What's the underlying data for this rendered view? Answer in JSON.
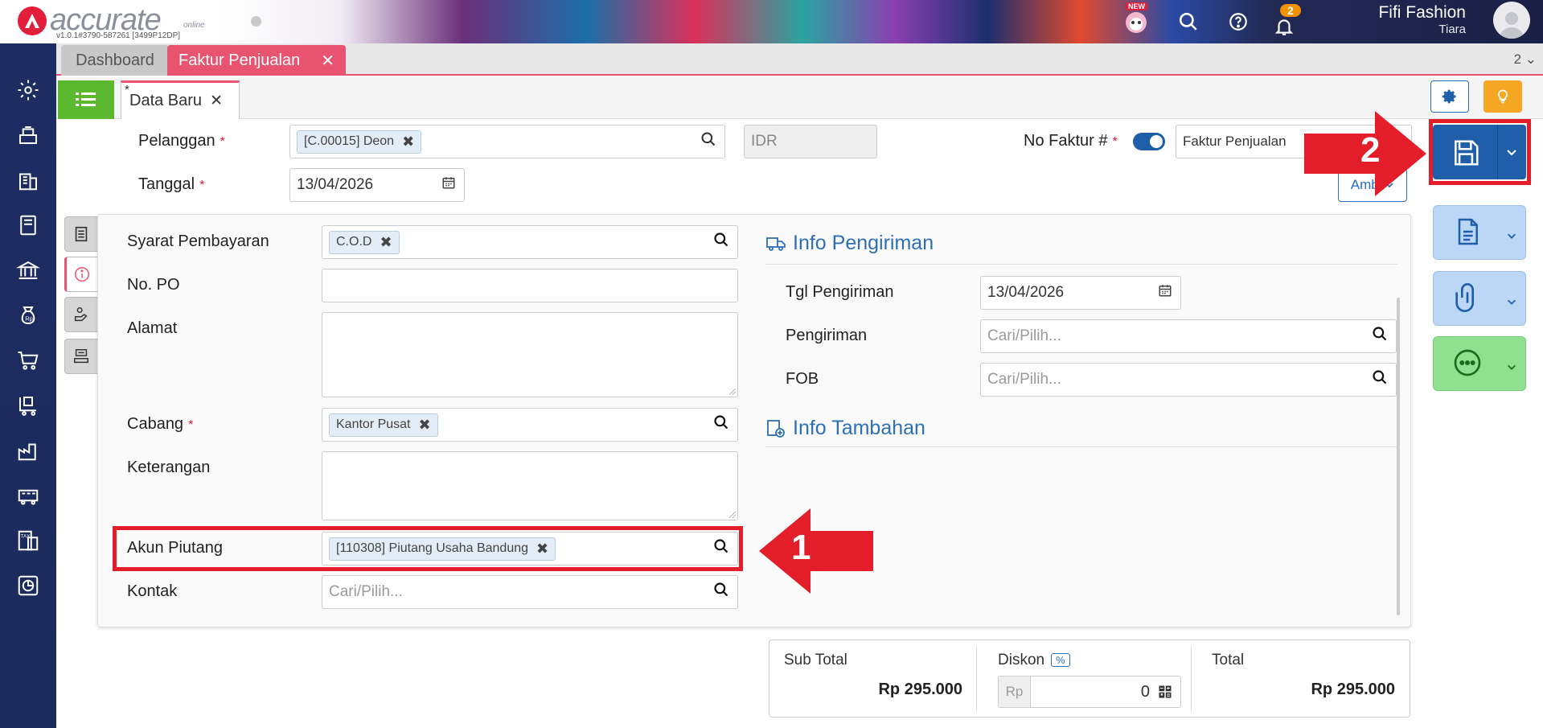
{
  "app": {
    "logo_text": "accurate",
    "logo_sub": "online",
    "version": "v1.0.1#3790-587261 [3499P12DP]",
    "new_badge": "NEW",
    "notif_count": "2",
    "user_name": "Fifi Fashion",
    "user_sub": "Tiara"
  },
  "tabs": {
    "dashboard": "Dashboard",
    "active": "Faktur Penjualan",
    "count": "2"
  },
  "subtab": {
    "star": "*",
    "label": "Data Baru"
  },
  "header_form": {
    "pelanggan_label": "Pelanggan",
    "pelanggan_value": "[C.00015] Deon",
    "currency": "IDR",
    "no_faktur_label": "No Faktur #",
    "no_faktur_value": "Faktur Penjualan",
    "tanggal_label": "Tanggal",
    "tanggal_value": "13/04/2026",
    "ambil_label": "Ambil",
    "required_mark": "*"
  },
  "panel_left": {
    "syarat_label": "Syarat Pembayaran",
    "syarat_value": "C.O.D",
    "po_label": "No. PO",
    "alamat_label": "Alamat",
    "cabang_label": "Cabang",
    "cabang_value": "Kantor Pusat",
    "keterangan_label": "Keterangan",
    "akun_label": "Akun Piutang",
    "akun_value": "[110308] Piutang Usaha Bandung",
    "kontak_label": "Kontak",
    "kontak_placeholder": "Cari/Pilih..."
  },
  "panel_right": {
    "pengiriman_title": "Info Pengiriman",
    "tgl_label": "Tgl Pengiriman",
    "tgl_value": "13/04/2026",
    "pengiriman_label": "Pengiriman",
    "pengiriman_placeholder": "Cari/Pilih...",
    "fob_label": "FOB",
    "fob_placeholder": "Cari/Pilih...",
    "tambahan_title": "Info Tambahan"
  },
  "totals": {
    "subtotal_label": "Sub Total",
    "subtotal_value": "Rp 295.000",
    "diskon_label": "Diskon",
    "diskon_pct": "%",
    "diskon_currency": "Rp",
    "diskon_value": "0",
    "total_label": "Total",
    "total_value": "Rp 295.000"
  },
  "annotations": {
    "step1": "1",
    "step2": "2"
  },
  "colors": {
    "brand_red": "#e31e3a",
    "accent_pink": "#e8536f",
    "primary_blue": "#1f5ea8",
    "sidebar_navy": "#1b2a5c",
    "list_green": "#5bb82f",
    "annotation_red": "#e31e2a"
  }
}
